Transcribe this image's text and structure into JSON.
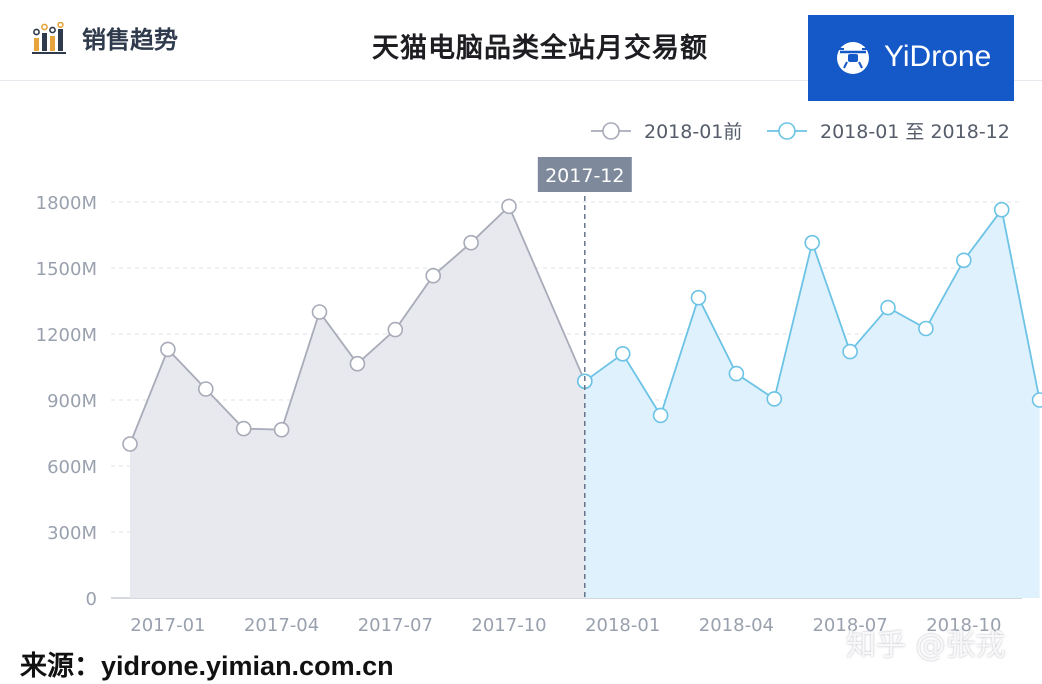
{
  "header": {
    "section_label": "销售趋势",
    "section_icon": "bar-chart-icon",
    "title": "天猫电脑品类全站月交易额",
    "brand": "YiDrone",
    "brand_icon": "drone-icon"
  },
  "footer": {
    "source": "来源：yidrone.yimian.com.cn",
    "watermark": "知乎 @张戎"
  },
  "colors": {
    "before_line": "#a8abb8",
    "before_fill": "#e6e8ee",
    "after_line": "#6cc3e6",
    "after_fill": "#dcf0fc",
    "brand": "#1558c7",
    "tooltip_bg": "#7e8a9c"
  },
  "chart_data": {
    "type": "area",
    "title": "天猫电脑品类全站月交易额",
    "x_ticks": [
      "2017-01",
      "2017-04",
      "2017-07",
      "2017-10",
      "2018-01",
      "2018-04",
      "2018-07",
      "2018-10"
    ],
    "y_ticks": [
      "0",
      "300M",
      "600M",
      "900M",
      "1200M",
      "1500M",
      "1800M"
    ],
    "ylim": [
      0,
      1800
    ],
    "unit": "M",
    "grid": true,
    "legend_position": "top-right",
    "highlight": "2017-12",
    "series": [
      {
        "name": "2018-01前",
        "x": [
          "2016-12",
          "2017-01",
          "2017-02",
          "2017-03",
          "2017-04",
          "2017-05",
          "2017-06",
          "2017-07",
          "2017-08",
          "2017-09",
          "2017-10",
          "2017-11",
          "2017-12"
        ],
        "values": [
          700,
          1130,
          950,
          770,
          765,
          1300,
          1065,
          1220,
          1465,
          1615,
          1780,
          null,
          985
        ]
      },
      {
        "name": "2018-01 至 2018-12",
        "x": [
          "2017-12",
          "2018-01",
          "2018-02",
          "2018-03",
          "2018-04",
          "2018-05",
          "2018-06",
          "2018-07",
          "2018-08",
          "2018-09",
          "2018-10",
          "2018-11",
          "2018-12"
        ],
        "values": [
          985,
          1110,
          830,
          1365,
          1020,
          905,
          1615,
          1120,
          1320,
          1225,
          1535,
          1765,
          900
        ]
      }
    ]
  }
}
